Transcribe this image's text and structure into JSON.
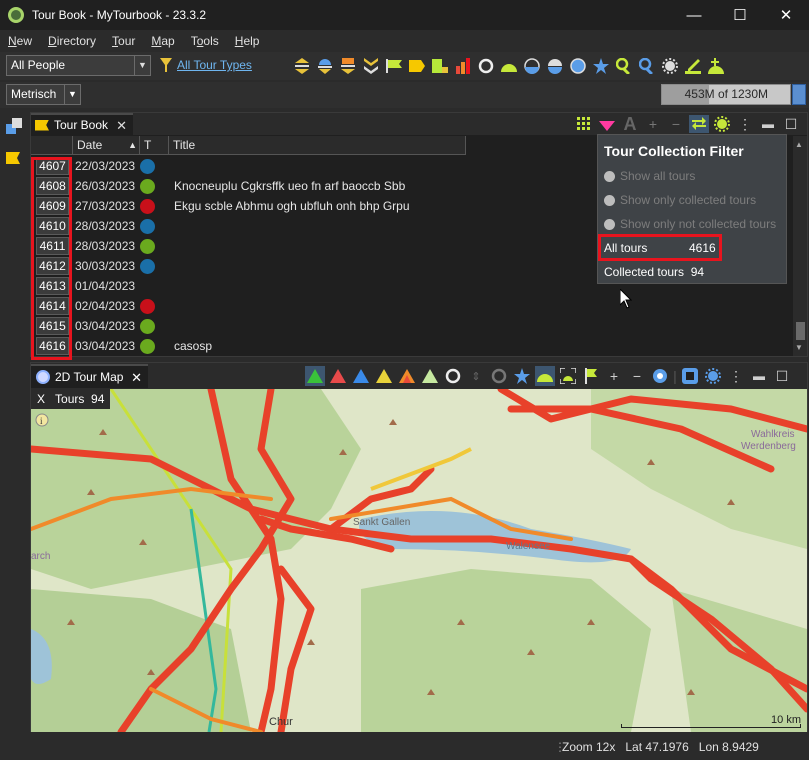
{
  "window": {
    "title": "Tour Book - MyTourbook - 23.3.2",
    "minimize": "—",
    "maximize": "☐",
    "close": "✕"
  },
  "menu": [
    {
      "pre": "",
      "u": "N",
      "post": "ew"
    },
    {
      "pre": "",
      "u": "D",
      "post": "irectory"
    },
    {
      "pre": "",
      "u": "T",
      "post": "our"
    },
    {
      "pre": "",
      "u": "M",
      "post": "ap"
    },
    {
      "pre": "T",
      "u": "o",
      "post": "ols"
    },
    {
      "pre": "",
      "u": "H",
      "post": "elp"
    }
  ],
  "toolbar": {
    "people_value": "All People",
    "tour_types_link": "All Tour Types",
    "measurement_value": "Metrisch",
    "memory_text": "453M of 1230M",
    "memory_used_fraction": 0.37
  },
  "tourbook": {
    "tab_label": "Tour Book",
    "columns": {
      "date": "Date",
      "type": "T",
      "title": "Title"
    },
    "rows": [
      {
        "id": "4607",
        "date": "22/03/2023",
        "color": "#1a6fa8",
        "title": ""
      },
      {
        "id": "4608",
        "date": "26/03/2023",
        "color": "#6aaa1e",
        "title": "Knocneuplu Cgkrsffk ueo fn arf baoccb Sbb"
      },
      {
        "id": "4609",
        "date": "27/03/2023",
        "color": "#c8101a",
        "title": "Ekgu scble Abhmu ogh ubfluh onh bhp Grpu"
      },
      {
        "id": "4610",
        "date": "28/03/2023",
        "color": "#1a6fa8",
        "title": ""
      },
      {
        "id": "4611",
        "date": "28/03/2023",
        "color": "#6aaa1e",
        "title": ""
      },
      {
        "id": "4612",
        "date": "30/03/2023",
        "color": "#1a6fa8",
        "title": ""
      },
      {
        "id": "4613",
        "date": "01/04/2023",
        "color": "",
        "title": ""
      },
      {
        "id": "4614",
        "date": "02/04/2023",
        "color": "#c8101a",
        "title": ""
      },
      {
        "id": "4615",
        "date": "03/04/2023",
        "color": "#6aaa1e",
        "title": ""
      },
      {
        "id": "4616",
        "date": "03/04/2023",
        "color": "#6aaa1e",
        "title": "casosp"
      }
    ]
  },
  "collection_filter": {
    "title": "Tour Collection Filter",
    "show_all": "Show all tours",
    "show_collected": "Show only collected tours",
    "show_not_collected": "Show only not collected tours",
    "all_tours_label": "All tours",
    "all_tours_value": "4616",
    "collected_label": "Collected tours",
    "collected_value": "94"
  },
  "map": {
    "tab_label": "2D Tour Map",
    "info_close": "X",
    "info_label": "Tours",
    "info_value": "94",
    "place_1": "Sankt Gallen",
    "place_2": "Walensee",
    "place_3": "Wahlkreis",
    "place_4": "Werdenberg",
    "place_5": "arch",
    "place_6": "Chur",
    "scale_label": "10 km"
  },
  "status": {
    "zoom": "Zoom 12x",
    "lat": "Lat 47.1976",
    "lon": "Lon 8.9429"
  },
  "colors": {
    "highlight": "#e8141e",
    "link": "#6fb6f0",
    "accent": "#f6c800"
  }
}
